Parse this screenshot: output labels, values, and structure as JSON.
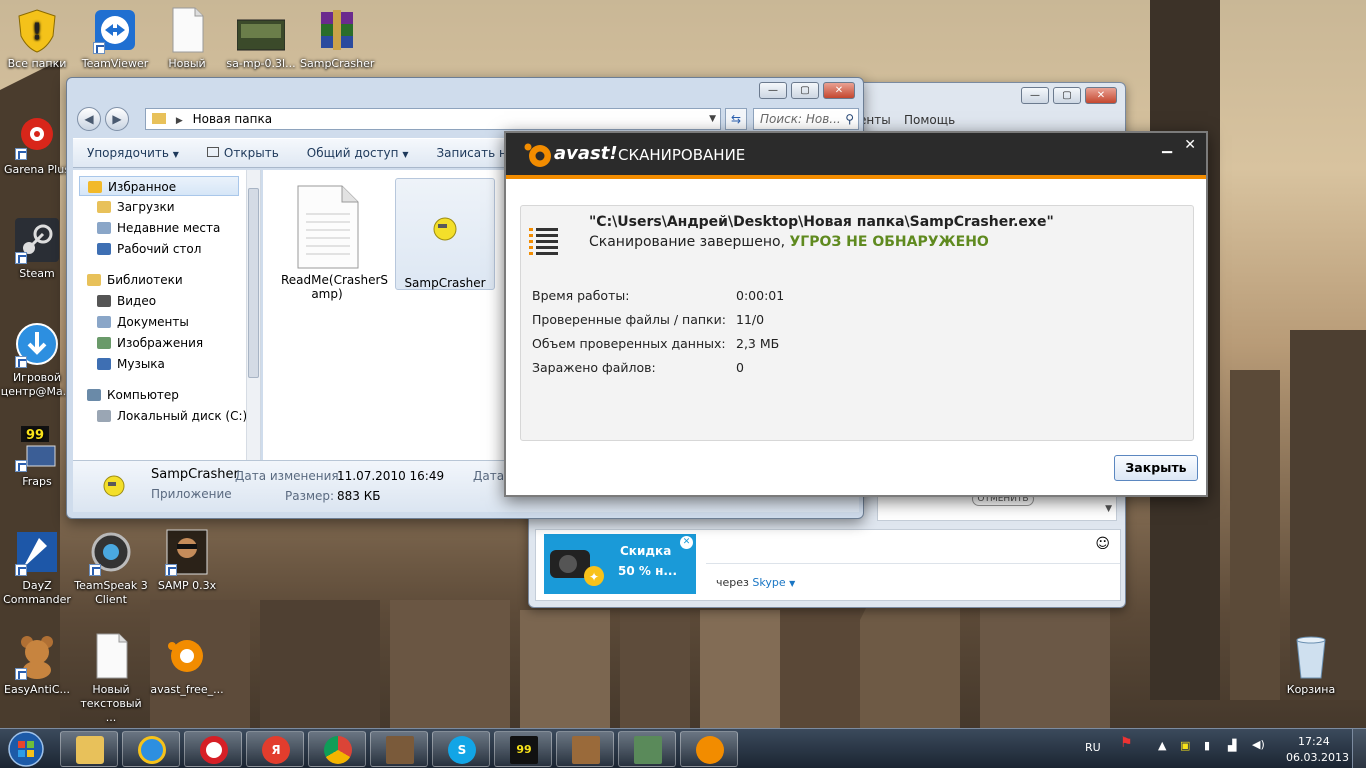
{
  "desktop_icons": [
    {
      "label": "Все папки",
      "icon": "shield-warning-icon"
    },
    {
      "label": "TeamViewer",
      "icon": "teamviewer-icon"
    },
    {
      "label": "Новый",
      "icon": "text-file-icon"
    },
    {
      "label": "sa-mp-0.3l...",
      "icon": "image-icon"
    },
    {
      "label": "SampCrasher",
      "icon": "winrar-icon"
    },
    {
      "label": "Garena Plus",
      "icon": "garena-icon"
    },
    {
      "label": "Steam",
      "icon": "steam-icon"
    },
    {
      "label": "Игровой центр@Ma...",
      "icon": "game-center-icon"
    },
    {
      "label": "Fraps",
      "icon": "fraps-icon"
    },
    {
      "label": "DayZ Commander",
      "icon": "dayz-icon"
    },
    {
      "label": "TeamSpeak 3 Client",
      "icon": "teamspeak-icon"
    },
    {
      "label": "SAMP 0.3x",
      "icon": "samp-icon"
    },
    {
      "label": "EasyAntiC...",
      "icon": "teddy-bear-icon"
    },
    {
      "label": "Новый текстовый ...",
      "icon": "text-file-icon"
    },
    {
      "label": "avast_free_...",
      "icon": "avast-icon"
    },
    {
      "label": "Корзина",
      "icon": "recycle-bin-icon"
    }
  ],
  "explorer": {
    "address": "Новая папка",
    "search_placeholder": "Поиск: Нов...",
    "toolbar": {
      "organize": "Упорядочить",
      "open": "Открыть",
      "share": "Общий доступ",
      "burn": "Записать на с"
    },
    "nav": [
      {
        "label": "Избранное",
        "icon": "star-icon",
        "kind": "group"
      },
      {
        "label": "Загрузки",
        "icon": "downloads-folder-icon",
        "kind": "item"
      },
      {
        "label": "Недавние места",
        "icon": "recent-places-icon",
        "kind": "item"
      },
      {
        "label": "Рабочий стол",
        "icon": "desktop-icon",
        "kind": "item"
      },
      {
        "label": "Библиотеки",
        "icon": "libraries-icon",
        "kind": "group"
      },
      {
        "label": "Видео",
        "icon": "video-icon",
        "kind": "item"
      },
      {
        "label": "Документы",
        "icon": "documents-icon",
        "kind": "item"
      },
      {
        "label": "Изображения",
        "icon": "pictures-icon",
        "kind": "item"
      },
      {
        "label": "Музыка",
        "icon": "music-icon",
        "kind": "item"
      },
      {
        "label": "Компьютер",
        "icon": "computer-icon",
        "kind": "group"
      },
      {
        "label": "Локальный диск (C:)",
        "icon": "drive-icon",
        "kind": "item"
      }
    ],
    "files": [
      {
        "name": "ReadMe(CrasherS amp)",
        "icon": "text-file-icon"
      },
      {
        "name": "SampCrasher",
        "icon": "app-icon"
      }
    ],
    "details": {
      "name": "SampCrasher",
      "type": "Приложение",
      "modified_label": "Дата изменения:",
      "modified_value": "11.07.2010 16:49",
      "size_label": "Размер:",
      "size_value": "883 КБ",
      "created_label": "Дата с"
    }
  },
  "skype": {
    "menu_1": "енты",
    "menu_2": "Помощь",
    "promo_title": "Скидка",
    "promo_sub": "50 % н...",
    "via_label": "через",
    "via_link": "Skype",
    "cancel": "ОТМЕНИТЬ"
  },
  "avast": {
    "brand": "avast!",
    "title": "СКАНИРОВАНИЕ",
    "file_path": "\"C:\\Users\\Андрей\\Desktop\\Новая папка\\SampCrasher.exe\"",
    "result_prefix": "Сканирование завершено,",
    "result_status": "УГРОЗ НЕ ОБНАРУЖЕНО",
    "stats": [
      {
        "label": "Время работы:",
        "value": "0:00:01"
      },
      {
        "label": "Проверенные файлы / папки:",
        "value": "11/0"
      },
      {
        "label": "Объем проверенных данных:",
        "value": "2,3 МБ"
      },
      {
        "label": "Заражено файлов:",
        "value": "0"
      }
    ],
    "close_button": "Закрыть",
    "accent_green": "#5f8a1f",
    "accent_orange": "#f28c00"
  },
  "taskbar": {
    "apps": [
      "explorer-icon",
      "ie-icon",
      "opera-icon",
      "yandex-icon",
      "chrome-icon",
      "samp-icon",
      "skype-icon",
      "fraps-icon",
      "samp-icon",
      "desktop-icon",
      "avast-icon"
    ],
    "lang": "RU",
    "time": "17:24",
    "date": "06.03.2013"
  }
}
